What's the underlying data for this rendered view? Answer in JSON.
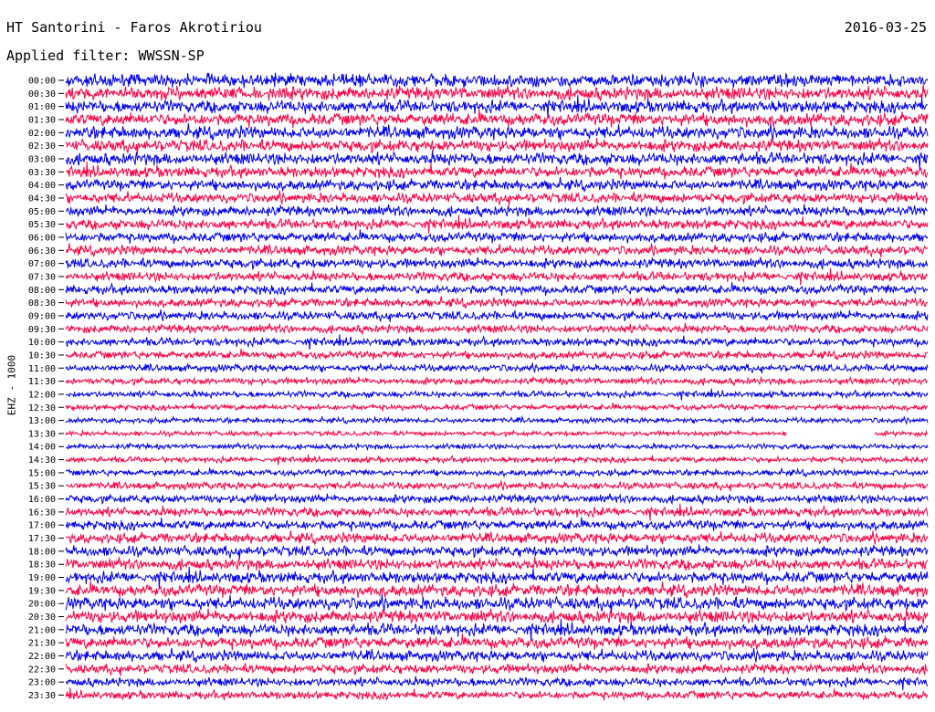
{
  "header": {
    "station": "HT Santorini - Faros Akrotiriou",
    "date": "2016-03-25",
    "filter_label": "Applied filter:",
    "filter_name": "WWSSN-SP"
  },
  "channel_label": "EHZ - 1000",
  "chart_data": {
    "type": "line",
    "title": "HT Santorini - Faros Akrotiriou",
    "date": "2016-03-25",
    "filter": "WWSSN-SP",
    "channel": "EHZ - 1000",
    "row_labels": [
      "00:00",
      "00:30",
      "01:00",
      "01:30",
      "02:00",
      "02:30",
      "03:00",
      "03:30",
      "04:00",
      "04:30",
      "05:00",
      "05:30",
      "06:00",
      "06:30",
      "07:00",
      "07:30",
      "08:00",
      "08:30",
      "09:00",
      "09:30",
      "10:00",
      "10:30",
      "11:00",
      "11:30",
      "12:00",
      "12:30",
      "13:00",
      "13:30",
      "14:00",
      "14:30",
      "15:00",
      "15:30",
      "16:00",
      "16:30",
      "17:00",
      "17:30",
      "18:00",
      "18:30",
      "19:00",
      "19:30",
      "20:00",
      "20:30",
      "21:00",
      "21:30",
      "22:00",
      "22:30",
      "23:00",
      "23:30"
    ],
    "row_minutes": 30,
    "colors": [
      "#0000ee",
      "#ff0044"
    ],
    "relative_amplitude": [
      1.35,
      1.35,
      1.3,
      1.3,
      1.3,
      1.25,
      1.25,
      1.15,
      1.1,
      1.05,
      1.05,
      1.05,
      1.0,
      1.0,
      1.0,
      0.95,
      0.95,
      0.9,
      0.9,
      0.85,
      0.85,
      0.8,
      0.75,
      0.7,
      0.65,
      0.6,
      0.55,
      0.5,
      0.55,
      0.6,
      0.65,
      0.75,
      0.85,
      0.95,
      1.0,
      1.05,
      1.1,
      1.15,
      1.2,
      1.25,
      1.3,
      1.3,
      1.25,
      1.2,
      1.1,
      1.0,
      0.9,
      0.85
    ],
    "data_gap": {
      "row_label": "13:30",
      "note": "no signal segment near end of row"
    }
  }
}
